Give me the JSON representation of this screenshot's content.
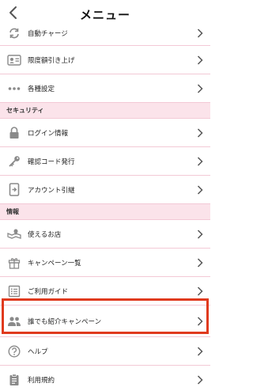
{
  "header": {
    "title": "メニュー"
  },
  "rows_top": [
    {
      "label": "自動チャージ",
      "icon": "sync-icon"
    },
    {
      "label": "限度額引き上げ",
      "icon": "id-card-icon"
    },
    {
      "label": "各種設定",
      "icon": "more-dots-icon"
    }
  ],
  "sections": [
    {
      "title": "セキュリティ"
    },
    {
      "title": "情報"
    }
  ],
  "security_rows": [
    {
      "label": "ログイン情報",
      "icon": "lock-icon"
    },
    {
      "label": "確認コード発行",
      "icon": "key-icon"
    },
    {
      "label": "アカウント引継",
      "icon": "phone-transfer-icon"
    }
  ],
  "info_rows": [
    {
      "label": "使えるお店",
      "icon": "map-icon"
    },
    {
      "label": "キャンペーン一覧",
      "icon": "gift-icon"
    },
    {
      "label": "ご利用ガイド",
      "icon": "guide-icon"
    },
    {
      "label": "誰でも紹介キャンペーン",
      "icon": "people-icon"
    },
    {
      "label": "ヘルプ",
      "icon": "help-icon"
    },
    {
      "label": "利用規約",
      "icon": "document-icon"
    }
  ],
  "colors": {
    "accent_border": "#e03a1e",
    "section_bg": "#fbe3ea",
    "divider": "#f3c9d6",
    "icon": "#8a8a8a"
  }
}
